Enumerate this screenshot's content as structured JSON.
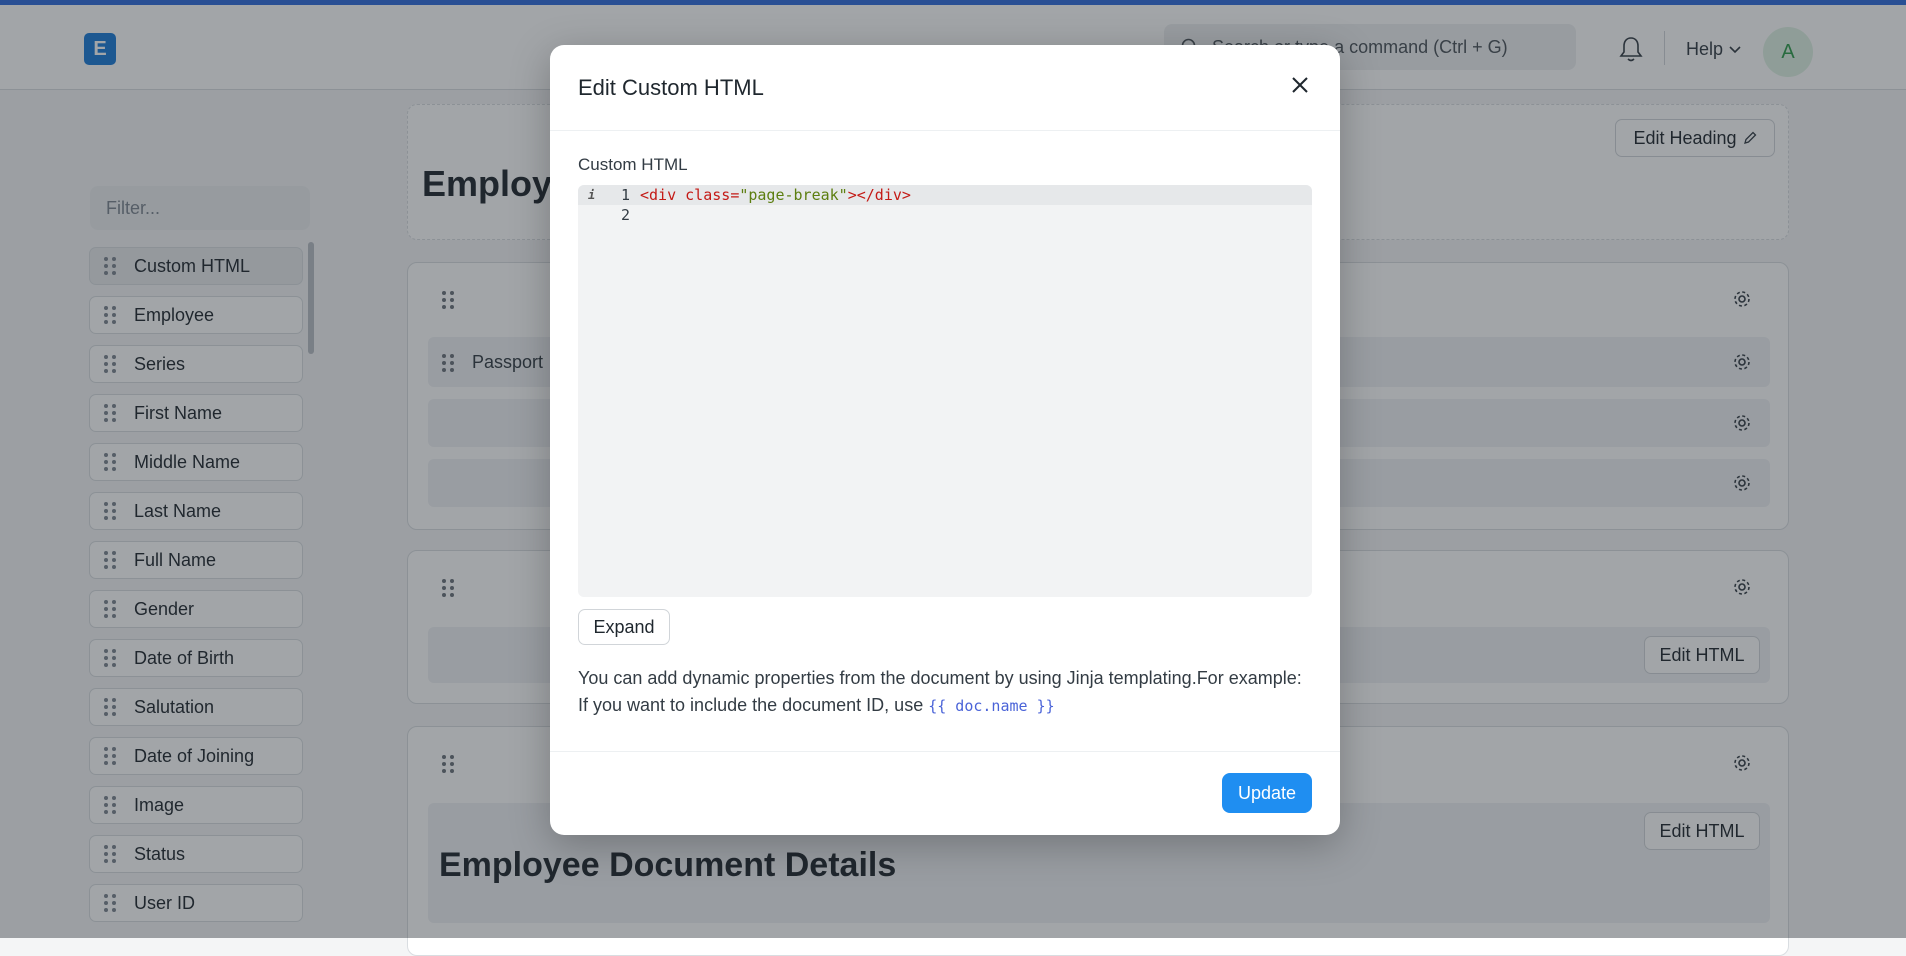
{
  "navbar": {
    "logo_letter": "E",
    "search_placeholder": "Search or type a command (Ctrl + G)",
    "help_label": "Help",
    "avatar_initial": "A"
  },
  "sidebar": {
    "filter_placeholder": "Filter...",
    "items": [
      {
        "label": "Custom HTML",
        "active": true
      },
      {
        "label": "Employee"
      },
      {
        "label": "Series"
      },
      {
        "label": "First Name"
      },
      {
        "label": "Middle Name"
      },
      {
        "label": "Last Name"
      },
      {
        "label": "Full Name"
      },
      {
        "label": "Gender"
      },
      {
        "label": "Date of Birth"
      },
      {
        "label": "Salutation"
      },
      {
        "label": "Date of Joining"
      },
      {
        "label": "Image"
      },
      {
        "label": "Status"
      },
      {
        "label": "User ID"
      }
    ]
  },
  "main": {
    "heading": "Employee",
    "edit_heading_label": "Edit Heading",
    "passport_label": "Passport",
    "edit_html_label": "Edit HTML",
    "doc_section_title": "Employee Document Details"
  },
  "modal": {
    "title": "Edit Custom HTML",
    "field_label": "Custom HTML",
    "code_lines": [
      {
        "number": "1",
        "open_tag": "<div",
        "attr": " class",
        "eq": "=",
        "value": "\"page-break\"",
        "close": "></div>"
      },
      {
        "number": "2"
      }
    ],
    "expand_label": "Expand",
    "help_text": "You can add dynamic properties from the document by using Jinja templating.For example: If you want to include the document ID, use",
    "help_code": "{{ doc.name }}",
    "update_label": "Update"
  },
  "colors": {
    "accent": "#2f6bdc",
    "primary_button": "#1f8ef1",
    "logo": "#1a7bd8"
  }
}
